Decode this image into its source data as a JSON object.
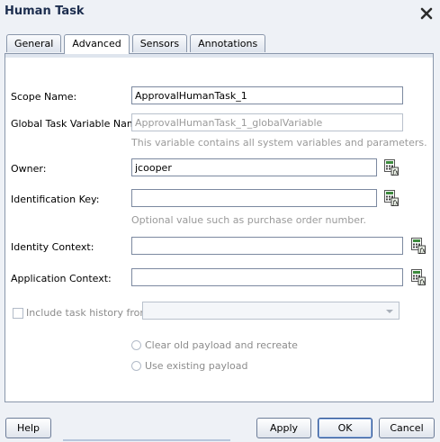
{
  "dialog": {
    "title": "Human Task"
  },
  "tabs": [
    {
      "label": "General",
      "active": false
    },
    {
      "label": "Advanced",
      "active": true
    },
    {
      "label": "Sensors",
      "active": false
    },
    {
      "label": "Annotations",
      "active": false
    }
  ],
  "form": {
    "scope_name": {
      "label": "Scope Name:",
      "value": "ApprovalHumanTask_1"
    },
    "global_task_variable": {
      "label": "Global Task Variable Name:",
      "value": "ApprovalHumanTask_1_globalVariable",
      "hint": "This variable contains all system variables and parameters."
    },
    "owner": {
      "label": "Owner:",
      "value": "jcooper"
    },
    "identification_key": {
      "label": "Identification Key:",
      "value": "",
      "hint": "Optional value such as purchase order number."
    },
    "identity_context": {
      "label": "Identity Context:",
      "value": ""
    },
    "application_context": {
      "label": "Application Context:",
      "value": ""
    },
    "include_history": {
      "label": "Include task history from:",
      "checked": false,
      "selected": ""
    },
    "radio_clear": {
      "label": "Clear old payload and recreate"
    },
    "radio_use": {
      "label": "Use existing payload"
    }
  },
  "buttons": {
    "help": "Help",
    "apply": "Apply",
    "ok": "OK",
    "cancel": "Cancel"
  },
  "icons": {
    "close": "close-icon",
    "expression_builder": "expression-builder-icon"
  },
  "colors": {
    "title": "#1d2e4f",
    "border": "#8a97ab",
    "disabled_text": "#9a9a9a",
    "icon_green": "#3d8a3d"
  }
}
